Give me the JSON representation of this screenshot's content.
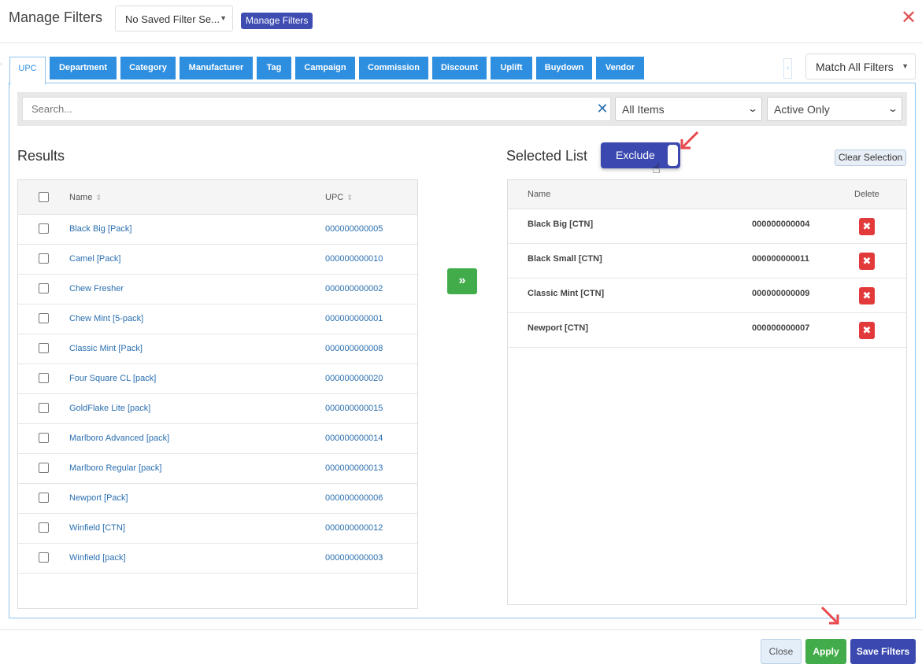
{
  "header": {
    "title": "Manage Filters",
    "saved_filter_value": "No Saved Filter Se...",
    "manage_button": "Manage Filters",
    "close_symbol": "✕"
  },
  "tabs": [
    {
      "label": "UPC",
      "active": true
    },
    {
      "label": "Department"
    },
    {
      "label": "Category"
    },
    {
      "label": "Manufacturer"
    },
    {
      "label": "Tag"
    },
    {
      "label": "Campaign"
    },
    {
      "label": "Commission"
    },
    {
      "label": "Discount"
    },
    {
      "label": "Uplift"
    },
    {
      "label": "Buydown"
    },
    {
      "label": "Vendor"
    }
  ],
  "match_select": {
    "value": "Match All Filters"
  },
  "search": {
    "placeholder": "Search...",
    "items_filter": "All Items",
    "status_filter": "Active Only"
  },
  "results": {
    "title": "Results",
    "columns": {
      "name": "Name",
      "upc": "UPC"
    },
    "rows": [
      {
        "name": "Black Big [Pack]",
        "upc": "000000000005"
      },
      {
        "name": "Camel [Pack]",
        "upc": "000000000010"
      },
      {
        "name": "Chew Fresher",
        "upc": "000000000002"
      },
      {
        "name": "Chew Mint [5-pack]",
        "upc": "000000000001"
      },
      {
        "name": "Classic Mint [Pack]",
        "upc": "000000000008"
      },
      {
        "name": "Four Square CL [pack]",
        "upc": "000000000020"
      },
      {
        "name": "GoldFlake Lite [pack]",
        "upc": "000000000015"
      },
      {
        "name": "Marlboro Advanced [pack]",
        "upc": "000000000014"
      },
      {
        "name": "Marlboro Regular [pack]",
        "upc": "000000000013"
      },
      {
        "name": "Newport [Pack]",
        "upc": "000000000006"
      },
      {
        "name": "Winfield [CTN]",
        "upc": "000000000012"
      },
      {
        "name": "Winfield [pack]",
        "upc": "000000000003"
      }
    ]
  },
  "move_symbol": "»",
  "selected": {
    "title": "Selected List",
    "exclude_label": "Exclude",
    "clear_label": "Clear Selection",
    "columns": {
      "name": "Name",
      "delete": "Delete"
    },
    "rows": [
      {
        "name": "Black Big [CTN]",
        "upc": "000000000004"
      },
      {
        "name": "Black Small [CTN]",
        "upc": "000000000011"
      },
      {
        "name": "Classic Mint [CTN]",
        "upc": "000000000009"
      },
      {
        "name": "Newport [CTN]",
        "upc": "000000000007"
      }
    ],
    "delete_symbol": "✖"
  },
  "footer": {
    "close": "Close",
    "apply": "Apply",
    "save": "Save Filters"
  },
  "colors": {
    "tab_blue": "#2e8fe0",
    "primary": "#3a48b0",
    "success": "#42ac4a",
    "danger": "#e23a3a",
    "annotation_arrow": "#e8474c"
  }
}
